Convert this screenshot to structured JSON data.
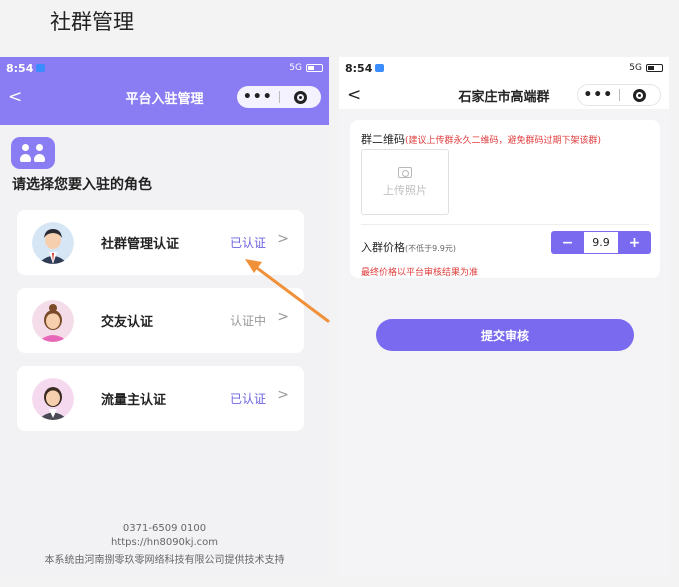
{
  "slide": {
    "title": "社群管理"
  },
  "left_phone": {
    "status_time": "8:54",
    "status_signal": "5G",
    "nav_title": "平台入驻管理",
    "back_glyph": "<",
    "capsule_more": "•••",
    "heading": "请选择您要入驻的角色",
    "roles": [
      {
        "name": "社群管理认证",
        "status": "已认证",
        "status_color": "#6c63e0",
        "avatar": "man-in-suit"
      },
      {
        "name": "交友认证",
        "status": "认证中",
        "status_color": "#999999",
        "avatar": "woman-pink"
      },
      {
        "name": "流量主认证",
        "status": "已认证",
        "status_color": "#6c63e0",
        "avatar": "woman-suit"
      }
    ],
    "chevron": ">",
    "footer": {
      "phone": "0371-6509 0100",
      "url": "https://hn8090kj.com",
      "company": "本系统由河南捌零玖零网络科技有限公司提供技术支持"
    }
  },
  "right_phone": {
    "status_time": "8:54",
    "status_signal": "5G",
    "nav_title": "石家庄市高端群",
    "back_glyph": "<",
    "capsule_more": "•••",
    "qr_label": "群二维码",
    "qr_hint": "(建议上传群永久二维码，避免群码过期下架该群)",
    "upload_text": "上传照片",
    "price_label": "入群价格",
    "price_sub": "(不低于9.9元)",
    "price_value": "9.9",
    "minus": "−",
    "plus": "+",
    "price_note": "最终价格以平台审核结果为准",
    "submit_label": "提交审核"
  },
  "colors": {
    "accent": "#8a7cf2",
    "button": "#7a6af0",
    "warning": "#e03c3c",
    "arrow": "#f0913a"
  }
}
